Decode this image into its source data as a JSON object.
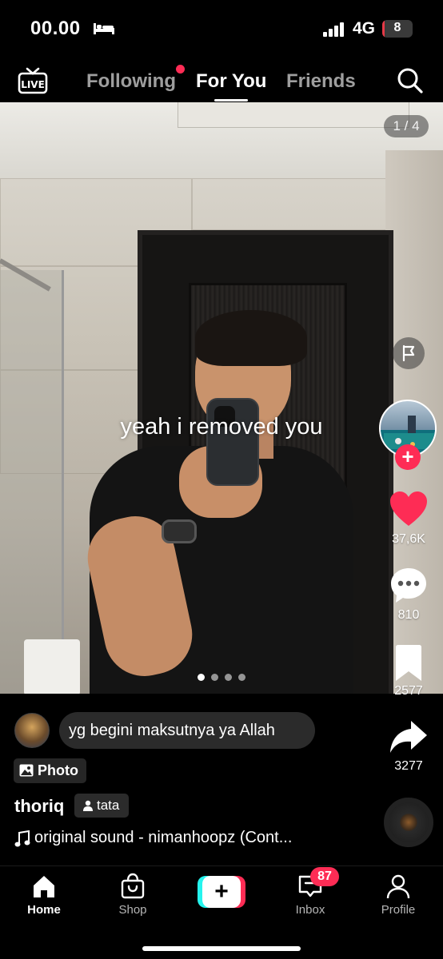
{
  "status_bar": {
    "time": "00.00",
    "network": "4G",
    "battery": "8",
    "battery_level": 0.08
  },
  "top_nav": {
    "live_icon": "live-tv-icon",
    "tabs": [
      {
        "label": "Following",
        "active": false,
        "has_dot": true
      },
      {
        "label": "For You",
        "active": true
      },
      {
        "label": "Friends",
        "active": false
      }
    ],
    "search_icon": "search-icon"
  },
  "post": {
    "page_counter": "1 / 4",
    "caption_overlay": "yeah i removed you",
    "carousel_total": 4,
    "carousel_index": 1
  },
  "actions": {
    "likes": "37,6K",
    "comments": "810",
    "bookmarks": "2577",
    "shares": "3277"
  },
  "info": {
    "top_comment": "yg begini maksutnya ya Allah",
    "type_tag": "Photo",
    "username": "thoriq",
    "tagged_user": "tata",
    "sound": "original sound - nimanhoopz (Cont..."
  },
  "tabbar": {
    "items": [
      {
        "label": "Home",
        "icon": "home-icon",
        "active": true
      },
      {
        "label": "Shop",
        "icon": "shopping-bag-icon",
        "active": false
      },
      {
        "label": "",
        "icon": "create-plus-icon",
        "active": false
      },
      {
        "label": "Inbox",
        "icon": "inbox-icon",
        "active": false
      },
      {
        "label": "Profile",
        "icon": "profile-icon",
        "active": false
      }
    ],
    "inbox_badge": "87"
  },
  "colors": {
    "accent_red": "#fe2c55",
    "accent_cyan": "#25f4ee",
    "background": "#000000"
  }
}
